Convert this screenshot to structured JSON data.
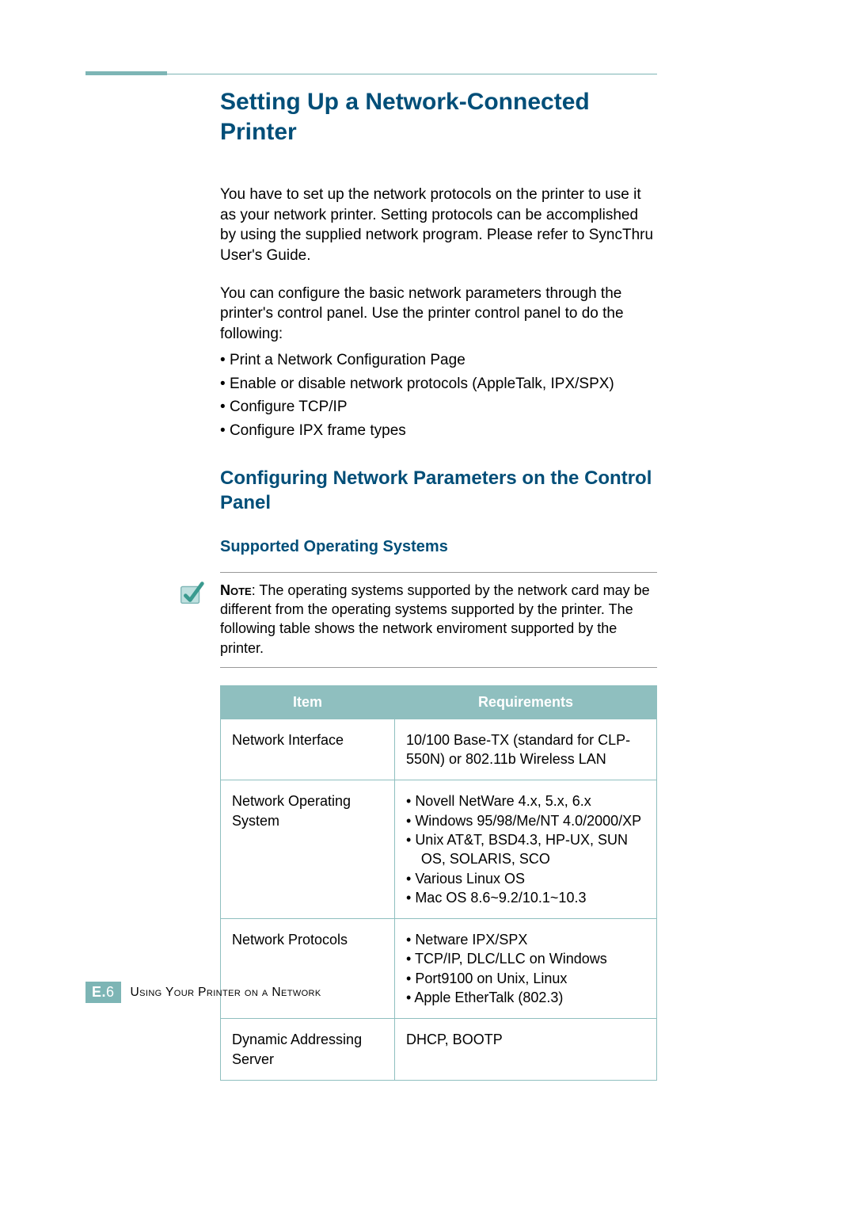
{
  "title": "Setting Up a Network-Connected Printer",
  "para1": "You have to set up the network protocols on the printer to use it as your network printer. Setting protocols can be accomplished by using the supplied network program. Please refer to SyncThru User's Guide.",
  "para2": "You can configure the basic network parameters through the printer's control panel. Use the printer control panel to do the following:",
  "bullets": [
    "Print a Network Configuration Page",
    "Enable or disable network protocols (AppleTalk, IPX/SPX)",
    "Configure TCP/IP",
    "Configure IPX frame types"
  ],
  "h2": "Configuring Network Parameters on the Control Panel",
  "h3": "Supported Operating Systems",
  "note_label": "Note",
  "note_body": ": The operating systems supported by the network card may be different from the operating systems supported by the printer. The following table shows the network enviroment supported by the printer.",
  "table": {
    "headers": {
      "c1": "Item",
      "c2": "Requirements"
    },
    "rows": [
      {
        "item": "Network Interface",
        "req_text": "10/100 Base-TX (standard for CLP-550N) or 802.11b Wireless LAN"
      },
      {
        "item": "Network Operating System",
        "req_list": [
          "Novell NetWare 4.x, 5.x, 6.x",
          "Windows 95/98/Me/NT 4.0/2000/XP",
          "Unix AT&T, BSD4.3, HP-UX, SUN OS, SOLARIS, SCO",
          "Various Linux OS",
          "Mac OS 8.6~9.2/10.1~10.3"
        ]
      },
      {
        "item": "Network Protocols",
        "req_list": [
          "Netware IPX/SPX",
          "TCP/IP, DLC/LLC on Windows",
          "Port9100 on Unix, Linux",
          "Apple EtherTalk (802.3)"
        ]
      },
      {
        "item": "Dynamic Addressing Server",
        "req_text": "DHCP, BOOTP"
      }
    ]
  },
  "footer": {
    "section_letter": "E.",
    "page_number": "6",
    "running_title": "Using Your Printer on a Network"
  }
}
